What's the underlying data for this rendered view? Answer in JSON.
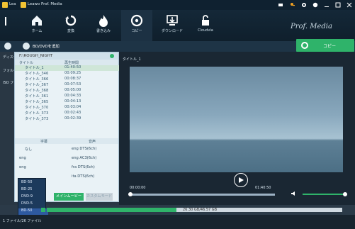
{
  "window": {
    "title_short": "Lea",
    "app_title": "Leawo Prof. Media",
    "brand_script": "Prof. Media",
    "controls": [
      "cart-icon",
      "key-icon",
      "gear-icon",
      "help-icon",
      "minimize-icon",
      "maximize-icon",
      "close-icon"
    ]
  },
  "toolbar": {
    "items": [
      {
        "label": "",
        "icon": "partial-icon"
      },
      {
        "label": "ホーム",
        "icon": "home-icon"
      },
      {
        "label": "変換",
        "icon": "convert-icon"
      },
      {
        "label": "書き込み",
        "icon": "burn-icon"
      },
      {
        "label": "コピー",
        "icon": "copy-disc-icon",
        "active": true
      },
      {
        "label": "ダウンロード",
        "icon": "download-icon"
      },
      {
        "label": "Cloudvia",
        "icon": "lock-icon"
      }
    ]
  },
  "appbar": {
    "tab_label": "BD/DVDを追加",
    "copy_button": "コピー",
    "left_hint_rows": [
      "ディスク様",
      "フォルダ",
      "ISO フ"
    ]
  },
  "popup": {
    "title": "F:\\ROUGH_NIGHT",
    "col_title": "タイトル",
    "col_duration": "再生時間",
    "titles": [
      {
        "name": "タイトル_1",
        "duration": "01:40:50",
        "selected": true
      },
      {
        "name": "タイトル_346",
        "duration": "00:09:25"
      },
      {
        "name": "タイトル_366",
        "duration": "00:08:37"
      },
      {
        "name": "タイトル_367",
        "duration": "00:07:53"
      },
      {
        "name": "タイトル_368",
        "duration": "00:05:00"
      },
      {
        "name": "タイトル_361",
        "duration": "00:04:33"
      },
      {
        "name": "タイトル_365",
        "duration": "00:04:13"
      },
      {
        "name": "タイトル_370",
        "duration": "00:03:04"
      },
      {
        "name": "タイトル_373",
        "duration": "00:02:43"
      },
      {
        "name": "タイトル_373",
        "duration": "00:02:39"
      }
    ],
    "col_subtitle": "字幕",
    "col_audio": "音声",
    "streams": [
      {
        "subtitle": "なし",
        "audio": "eng DTS(6ch)"
      },
      {
        "subtitle": "eng",
        "audio": "eng AC3(6ch)"
      },
      {
        "subtitle": "eng",
        "audio": "fra DTS(6ch)"
      },
      {
        "subtitle": "",
        "audio": "ita DTS(6ch)"
      }
    ]
  },
  "quality": {
    "options": [
      "BD-50",
      "BD-25",
      "DVD-9",
      "DVD-5",
      "BD-50"
    ],
    "selected_index": 4
  },
  "buttons": {
    "main_movie": "メインムービー",
    "custom_mode": "カスタムモード"
  },
  "progress": {
    "value": 0.44,
    "text": "26.30 GB/46.57 GB"
  },
  "status": {
    "files": "1 ファイル/26 ファイル"
  },
  "preview": {
    "title": "タイトル_1",
    "time_current": "00:00:00",
    "time_total": "01:40:50",
    "volume_level": 0.9
  },
  "colors": {
    "accent": "#2fb36a",
    "bg_dark": "#0f2130",
    "panel": "#e9f2f6"
  }
}
